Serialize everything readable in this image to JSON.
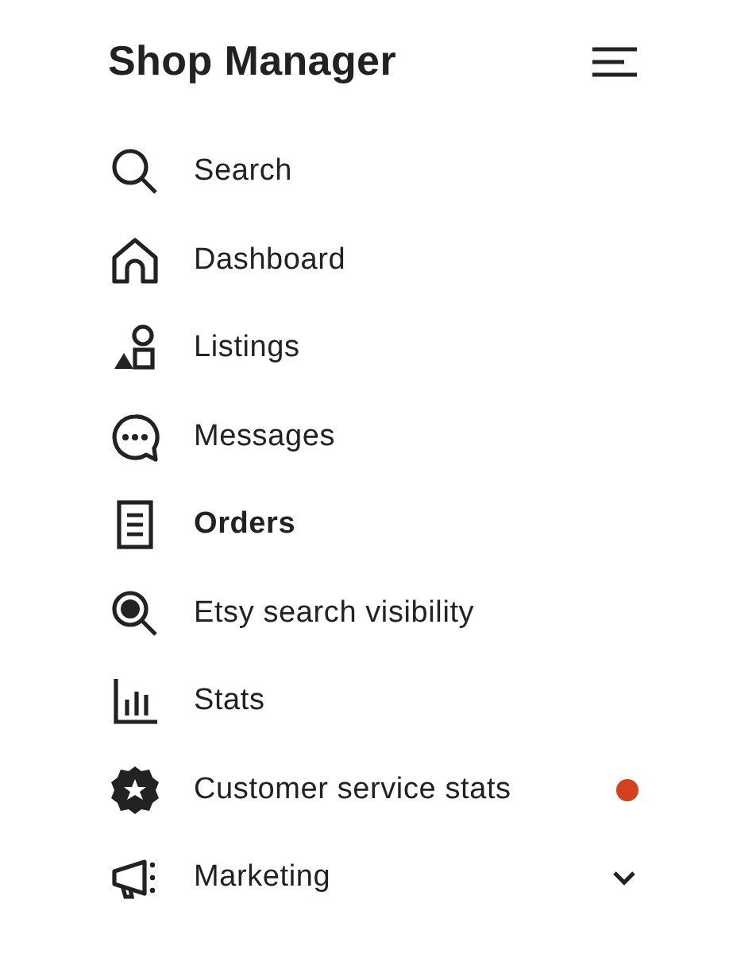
{
  "header": {
    "title": "Shop Manager"
  },
  "nav_items": [
    {
      "label": "Search",
      "selected": false
    },
    {
      "label": "Dashboard",
      "selected": false
    },
    {
      "label": "Listings",
      "selected": false
    },
    {
      "label": "Messages",
      "selected": false
    },
    {
      "label": "Orders",
      "selected": true
    },
    {
      "label": "Etsy search visibility",
      "selected": false
    },
    {
      "label": "Stats",
      "selected": false
    },
    {
      "label": "Customer service stats",
      "selected": false,
      "color": "#d3421d"
    },
    {
      "label": "Marketing",
      "selected": false,
      "expanded": false
    }
  ]
}
